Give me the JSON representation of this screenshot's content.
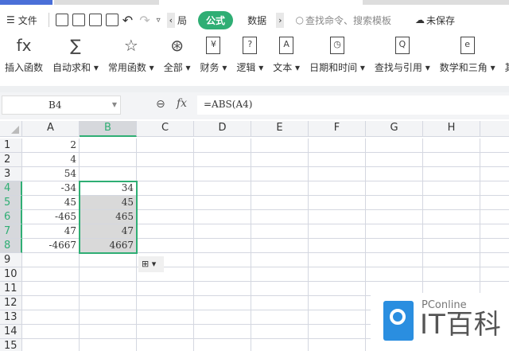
{
  "toolbar": {
    "file": "文件",
    "prev_tab": "局",
    "active_tab": "公式",
    "next_tab": "数据",
    "search_placeholder": "查找命令、搜索模板",
    "save_status": "未保存"
  },
  "ribbon": [
    {
      "icon": "fx",
      "label": "插入函数"
    },
    {
      "icon": "∑",
      "label": "自动求和 ▾"
    },
    {
      "icon": "☆",
      "label": "常用函数 ▾"
    },
    {
      "icon": "⊛",
      "label": "全部 ▾"
    },
    {
      "icon": "¥",
      "label": "财务 ▾"
    },
    {
      "icon": "?",
      "label": "逻辑 ▾"
    },
    {
      "icon": "A",
      "label": "文本 ▾"
    },
    {
      "icon": "◷",
      "label": "日期和时间 ▾"
    },
    {
      "icon": "Q",
      "label": "查找与引用 ▾"
    },
    {
      "icon": "e",
      "label": "数学和三角 ▾"
    },
    {
      "icon": "",
      "label": "其"
    }
  ],
  "formula_bar": {
    "name_box": "B4",
    "fx": "fx",
    "formula": "=ABS(A4)"
  },
  "sheet": {
    "columns": [
      "A",
      "B",
      "C",
      "D",
      "E",
      "F",
      "G",
      "H",
      ""
    ],
    "selected_column": "B",
    "row_count": 15,
    "selected_rows": [
      4,
      5,
      6,
      7,
      8
    ],
    "colA": [
      "2",
      "4",
      "54",
      "-34",
      "45",
      "-465",
      "47",
      "-4667"
    ],
    "colB": [
      "",
      "",
      "",
      "34",
      "45",
      "465",
      "47",
      "4667"
    ]
  },
  "paste_options": "⊞ ▾",
  "watermark": {
    "brand": "PConline",
    "name": "IT百科"
  }
}
